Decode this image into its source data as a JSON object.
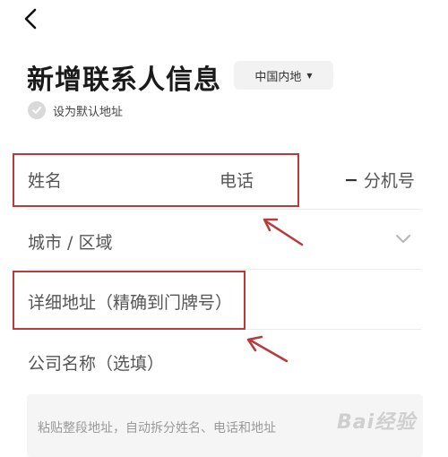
{
  "title": "新增联系人信息",
  "region": {
    "label": "中国内地"
  },
  "default_address": {
    "label": "设为默认地址",
    "checked": false
  },
  "fields": {
    "name": "姓名",
    "phone": "电话",
    "extension": "分机号",
    "city_area": "城市 / 区域",
    "detail_address": "详细地址（精确到门牌号）",
    "company": "公司名称（选填）"
  },
  "paste_placeholder": "粘贴整段地址，自动拆分姓名、电话和地址",
  "watermark": "Bai经验",
  "colors": {
    "annotation": "#b83a3a",
    "check_bg": "#d9d9d9",
    "region_bg": "#f2f2f2",
    "paste_bg": "#f5f5f5"
  },
  "icons": [
    "back-arrow-icon",
    "dropdown-triangle-icon",
    "check-icon",
    "chevron-down-icon"
  ]
}
